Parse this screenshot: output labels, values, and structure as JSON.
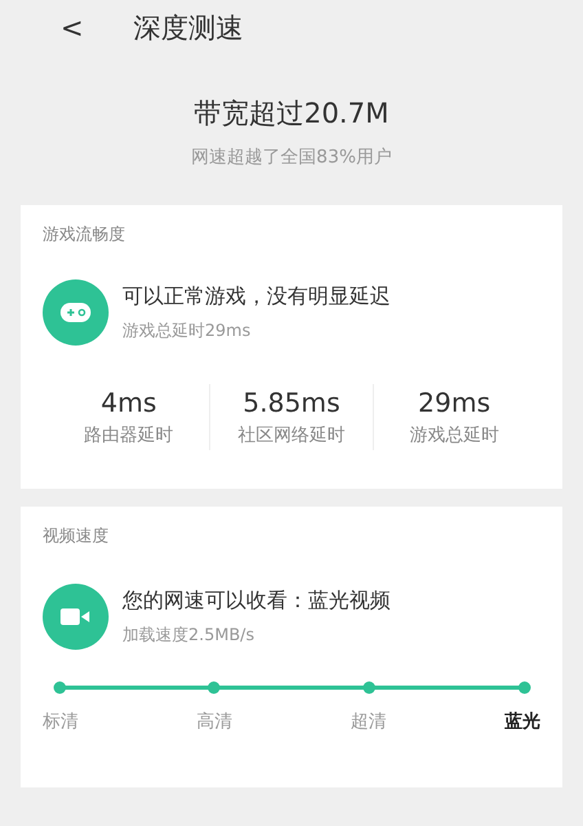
{
  "header": {
    "back": "<",
    "title": "深度测速"
  },
  "summary": {
    "headline": "带宽超过20.7M",
    "subtitle": "网速超越了全国83%用户"
  },
  "game_card": {
    "label": "游戏流畅度",
    "status": "可以正常游戏，没有明显延迟",
    "detail": "游戏总延时29ms",
    "stats": [
      {
        "value": "4ms",
        "label": "路由器延时"
      },
      {
        "value": "5.85ms",
        "label": "社区网络延时"
      },
      {
        "value": "29ms",
        "label": "游戏总延时"
      }
    ]
  },
  "video_card": {
    "label": "视频速度",
    "status": "您的网速可以收看：蓝光视频",
    "detail": "加载速度2.5MB/s",
    "level": 1,
    "qualities": [
      {
        "label": "标清",
        "selected": false
      },
      {
        "label": "高清",
        "selected": false
      },
      {
        "label": "超清",
        "selected": false
      },
      {
        "label": "蓝光",
        "selected": true
      }
    ]
  }
}
